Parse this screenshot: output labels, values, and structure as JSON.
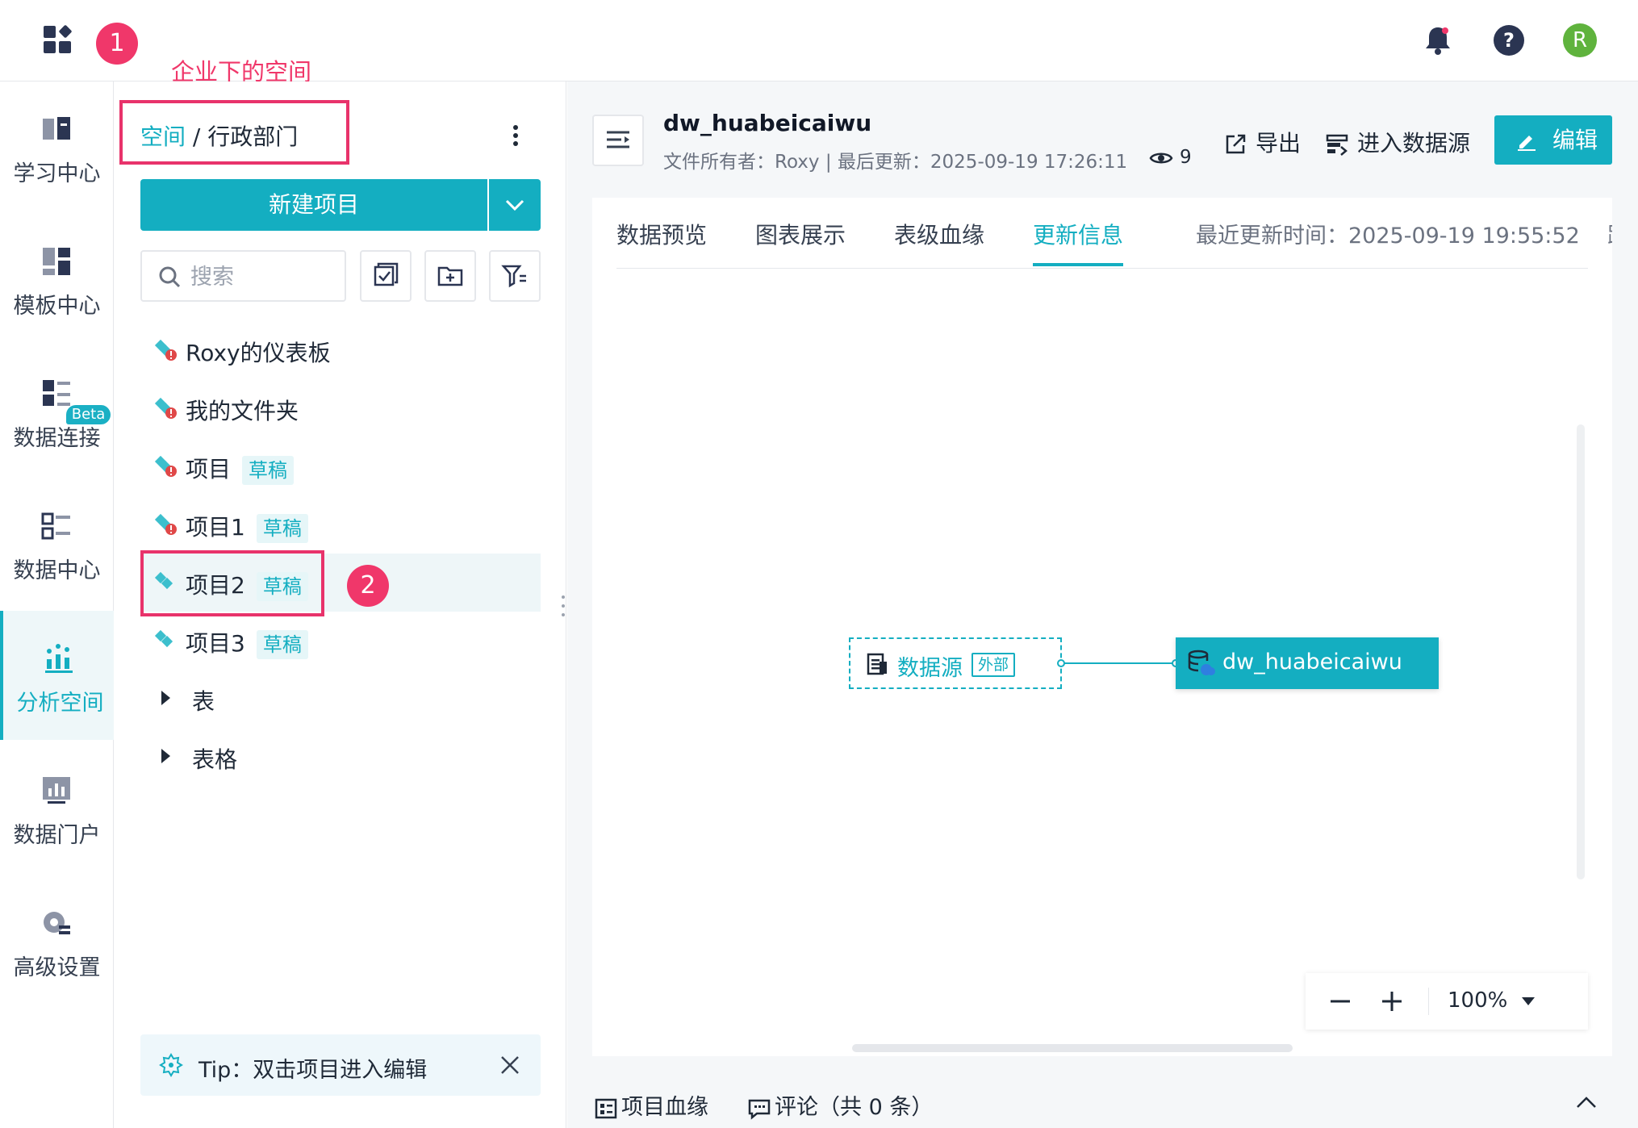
{
  "annotations": {
    "marker_1": "1",
    "marker_2": "2",
    "space_note": "企业下的空间"
  },
  "topbar": {
    "avatar_letter": "R"
  },
  "nav": {
    "items": [
      {
        "label": "学习中心"
      },
      {
        "label": "模板中心"
      },
      {
        "label": "数据连接"
      },
      {
        "label": "数据中心",
        "badge": "Beta"
      },
      {
        "label": "分析空间",
        "active": true
      },
      {
        "label": "数据门户"
      },
      {
        "label": "高级设置"
      }
    ]
  },
  "tree": {
    "breadcrumb_root": "空间",
    "breadcrumb_sep": " / ",
    "breadcrumb_current": "行政部门",
    "new_button": "新建项目",
    "search_placeholder": "搜索",
    "items": [
      {
        "label": "Roxy的仪表板"
      },
      {
        "label": "我的文件夹"
      },
      {
        "label": "项目",
        "tag": "草稿"
      },
      {
        "label": "项目1",
        "tag": "草稿"
      },
      {
        "label": "项目2",
        "tag": "草稿",
        "selected": true
      },
      {
        "label": "项目3",
        "tag": "草稿"
      }
    ],
    "folders": [
      {
        "label": "表"
      },
      {
        "label": "表格"
      }
    ],
    "tip": "Tip：双击项目进入编辑"
  },
  "header": {
    "title": "dw_huabeicaiwu",
    "meta": "文件所有者：Roxy | 最后更新：2025-09-19 17:26:11",
    "views": "9",
    "export": "导出",
    "enter_source": "进入数据源",
    "edit": "编辑"
  },
  "tabs": {
    "items": [
      "数据预览",
      "图表展示",
      "表级血缘",
      "更新信息"
    ],
    "active": "更新信息",
    "recent_update": "最近更新时间：2025-09-19 19:55:52",
    "overflow": "路"
  },
  "lineage": {
    "source_label": "数据源",
    "source_tag": "外部",
    "target_label": "dw_huabeicaiwu"
  },
  "zoom": {
    "value": "100%"
  },
  "bottom": {
    "lineage_tab": "项目血缘",
    "comment_tab": "评论（共 0 条）"
  },
  "colors": {
    "accent": "#14aec1",
    "annotation": "#e8336b"
  }
}
